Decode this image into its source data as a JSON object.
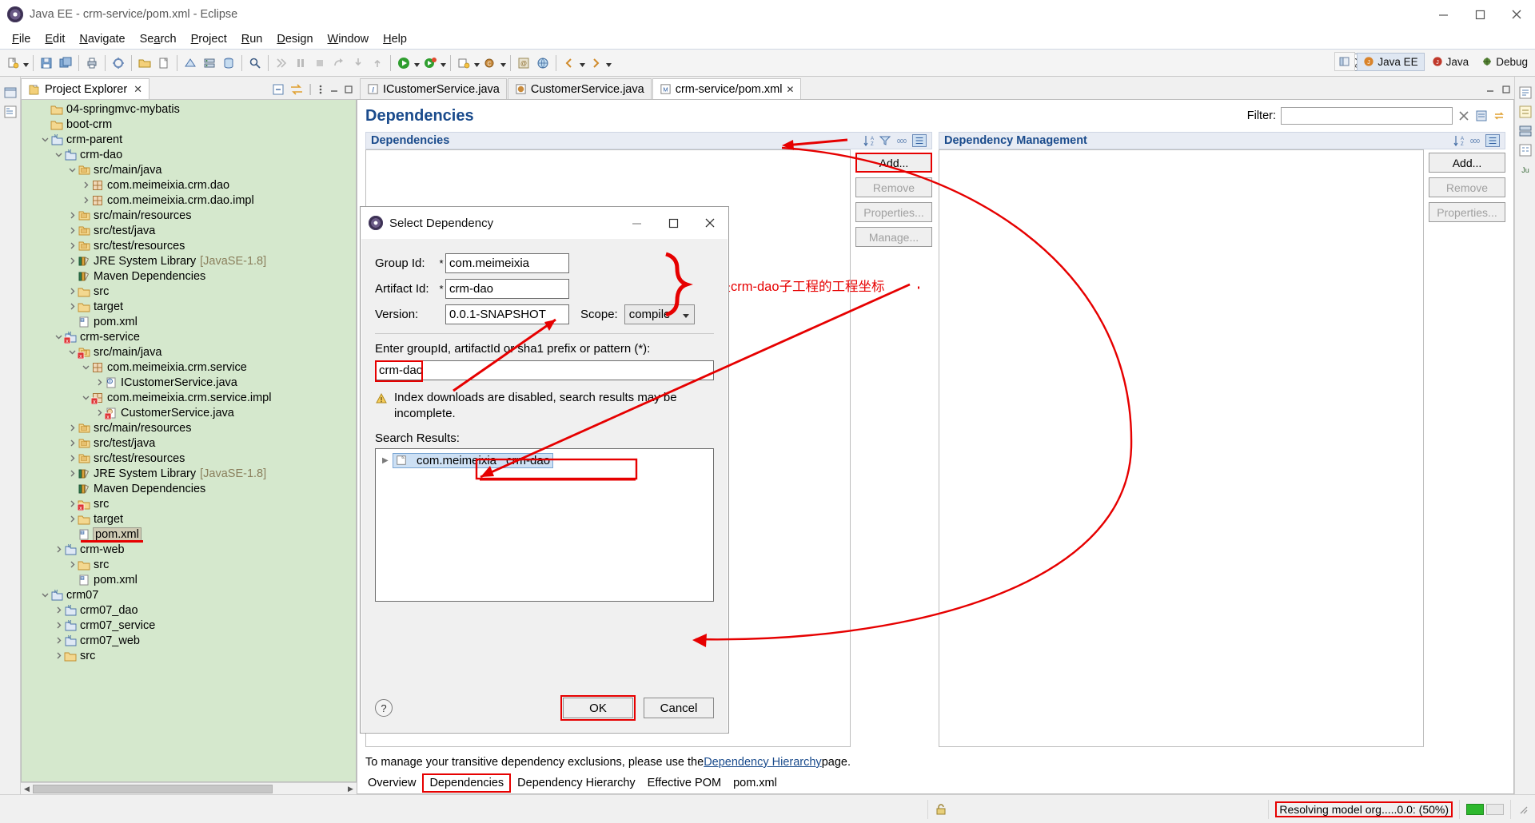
{
  "window": {
    "title": "Java EE - crm-service/pom.xml - Eclipse",
    "app_icon": "eclipse-icon",
    "minimize": "minimize-button",
    "maximize": "maximize-button",
    "close": "close-button"
  },
  "menubar": {
    "items": [
      {
        "label": "File",
        "mnemonic": "F"
      },
      {
        "label": "Edit",
        "mnemonic": "E"
      },
      {
        "label": "Navigate",
        "mnemonic": "N"
      },
      {
        "label": "Search",
        "mnemonic": "a"
      },
      {
        "label": "Project",
        "mnemonic": "P"
      },
      {
        "label": "Run",
        "mnemonic": "R"
      },
      {
        "label": "Design",
        "mnemonic": "D"
      },
      {
        "label": "Window",
        "mnemonic": "W"
      },
      {
        "label": "Help",
        "mnemonic": "H"
      }
    ]
  },
  "toolbar": {
    "quick_access": "Quick Access",
    "perspectives": [
      {
        "label": "Java EE",
        "active": true
      },
      {
        "label": "Java",
        "active": false
      },
      {
        "label": "Debug",
        "active": false
      }
    ]
  },
  "explorer": {
    "tab_label": "Project Explorer",
    "tab_close": "✕",
    "background_color": "#d5e8cd",
    "tree": [
      {
        "depth": 1,
        "twisty": "",
        "icon": "folder-icon",
        "label": "04-springmvc-mybatis",
        "suffix": ""
      },
      {
        "depth": 1,
        "twisty": "",
        "icon": "folder-icon",
        "label": "boot-crm",
        "suffix": ""
      },
      {
        "depth": 1,
        "twisty": "open",
        "icon": "maven-project-icon",
        "label": "crm-parent",
        "suffix": ""
      },
      {
        "depth": 2,
        "twisty": "open",
        "icon": "maven-project-icon",
        "label": "crm-dao",
        "suffix": ""
      },
      {
        "depth": 3,
        "twisty": "open",
        "icon": "source-folder-icon",
        "label": "src/main/java",
        "suffix": ""
      },
      {
        "depth": 4,
        "twisty": "closed",
        "icon": "package-icon",
        "label": "com.meimeixia.crm.dao",
        "suffix": ""
      },
      {
        "depth": 4,
        "twisty": "closed",
        "icon": "package-icon",
        "label": "com.meimeixia.crm.dao.impl",
        "suffix": ""
      },
      {
        "depth": 3,
        "twisty": "closed",
        "icon": "source-folder-icon",
        "label": "src/main/resources",
        "suffix": ""
      },
      {
        "depth": 3,
        "twisty": "closed",
        "icon": "source-folder-icon",
        "label": "src/test/java",
        "suffix": ""
      },
      {
        "depth": 3,
        "twisty": "closed",
        "icon": "source-folder-icon",
        "label": "src/test/resources",
        "suffix": ""
      },
      {
        "depth": 3,
        "twisty": "closed",
        "icon": "library-icon",
        "label": "JRE System Library",
        "suffix": "[JavaSE-1.8]"
      },
      {
        "depth": 3,
        "twisty": "",
        "icon": "library-icon",
        "label": "Maven Dependencies",
        "suffix": ""
      },
      {
        "depth": 3,
        "twisty": "closed",
        "icon": "folder-icon",
        "label": "src",
        "suffix": ""
      },
      {
        "depth": 3,
        "twisty": "closed",
        "icon": "folder-icon",
        "label": "target",
        "suffix": ""
      },
      {
        "depth": 3,
        "twisty": "",
        "icon": "pom-file-icon",
        "label": "pom.xml",
        "suffix": ""
      },
      {
        "depth": 2,
        "twisty": "open",
        "icon": "maven-project-error-icon",
        "label": "crm-service",
        "suffix": ""
      },
      {
        "depth": 3,
        "twisty": "open",
        "icon": "source-folder-error-icon",
        "label": "src/main/java",
        "suffix": ""
      },
      {
        "depth": 4,
        "twisty": "open",
        "icon": "package-icon",
        "label": "com.meimeixia.crm.service",
        "suffix": ""
      },
      {
        "depth": 5,
        "twisty": "closed",
        "icon": "java-interface-icon",
        "label": "ICustomerService.java",
        "suffix": ""
      },
      {
        "depth": 4,
        "twisty": "open",
        "icon": "package-error-icon",
        "label": "com.meimeixia.crm.service.impl",
        "suffix": ""
      },
      {
        "depth": 5,
        "twisty": "closed",
        "icon": "java-class-error-icon",
        "label": "CustomerService.java",
        "suffix": ""
      },
      {
        "depth": 3,
        "twisty": "closed",
        "icon": "source-folder-icon",
        "label": "src/main/resources",
        "suffix": ""
      },
      {
        "depth": 3,
        "twisty": "closed",
        "icon": "source-folder-icon",
        "label": "src/test/java",
        "suffix": ""
      },
      {
        "depth": 3,
        "twisty": "closed",
        "icon": "source-folder-icon",
        "label": "src/test/resources",
        "suffix": ""
      },
      {
        "depth": 3,
        "twisty": "closed",
        "icon": "library-icon",
        "label": "JRE System Library",
        "suffix": "[JavaSE-1.8]"
      },
      {
        "depth": 3,
        "twisty": "",
        "icon": "library-icon",
        "label": "Maven Dependencies",
        "suffix": ""
      },
      {
        "depth": 3,
        "twisty": "closed",
        "icon": "folder-error-icon",
        "label": "src",
        "suffix": ""
      },
      {
        "depth": 3,
        "twisty": "closed",
        "icon": "folder-icon",
        "label": "target",
        "suffix": ""
      },
      {
        "depth": 3,
        "twisty": "",
        "icon": "pom-file-icon",
        "label": "pom.xml",
        "suffix": "",
        "selected": true,
        "annotated": true
      },
      {
        "depth": 2,
        "twisty": "closed",
        "icon": "maven-project-icon",
        "label": "crm-web",
        "suffix": ""
      },
      {
        "depth": 3,
        "twisty": "closed",
        "icon": "folder-icon",
        "label": "src",
        "suffix": ""
      },
      {
        "depth": 3,
        "twisty": "",
        "icon": "pom-file-icon",
        "label": "pom.xml",
        "suffix": ""
      },
      {
        "depth": 1,
        "twisty": "open",
        "icon": "maven-project-icon",
        "label": "crm07",
        "suffix": ""
      },
      {
        "depth": 2,
        "twisty": "closed",
        "icon": "maven-project-icon",
        "label": "crm07_dao",
        "suffix": ""
      },
      {
        "depth": 2,
        "twisty": "closed",
        "icon": "maven-project-icon",
        "label": "crm07_service",
        "suffix": ""
      },
      {
        "depth": 2,
        "twisty": "closed",
        "icon": "maven-project-icon",
        "label": "crm07_web",
        "suffix": ""
      },
      {
        "depth": 2,
        "twisty": "closed",
        "icon": "folder-icon",
        "label": "src",
        "suffix": ""
      }
    ]
  },
  "editor": {
    "tabs": [
      {
        "label": "ICustomerService.java",
        "icon": "java-interface-icon",
        "active": false,
        "closable": false
      },
      {
        "label": "CustomerService.java",
        "icon": "java-class-icon",
        "active": false,
        "closable": false
      },
      {
        "label": "crm-service/pom.xml",
        "icon": "pom-file-icon",
        "active": true,
        "closable": true,
        "close": "✕"
      }
    ],
    "page_title": "Dependencies",
    "filter_label": "Filter:",
    "filter_value": "",
    "sections": [
      {
        "title": "Dependencies",
        "buttons": [
          {
            "label": "Add...",
            "enabled": true,
            "highlighted": true
          },
          {
            "label": "Remove",
            "enabled": false
          },
          {
            "label": "Properties...",
            "enabled": false
          },
          {
            "label": "Manage...",
            "enabled": false
          }
        ]
      },
      {
        "title": "Dependency Management",
        "buttons": [
          {
            "label": "Add...",
            "enabled": true,
            "highlighted": false
          },
          {
            "label": "Remove",
            "enabled": false
          },
          {
            "label": "Properties...",
            "enabled": false
          }
        ]
      }
    ],
    "footer_prefix": "To manage your transitive dependency exclusions, please use the ",
    "footer_link": "Dependency Hierarchy",
    "footer_suffix": " page.",
    "form_tabs": [
      {
        "label": "Overview",
        "active": false
      },
      {
        "label": "Dependencies",
        "active": true
      },
      {
        "label": "Dependency Hierarchy",
        "active": false
      },
      {
        "label": "Effective POM",
        "active": false
      },
      {
        "label": "pom.xml",
        "active": false
      }
    ]
  },
  "dialog": {
    "title": "Select Dependency",
    "icon": "eclipse-icon",
    "minimize": "—",
    "maximize": "□",
    "close": "✕",
    "fields": [
      {
        "label": "Group Id:",
        "required": true,
        "value": "com.meimeixia"
      },
      {
        "label": "Artifact Id:",
        "required": true,
        "value": "crm-dao"
      },
      {
        "label": "Version:",
        "required": false,
        "value": "0.0.1-SNAPSHOT"
      }
    ],
    "scope_label": "Scope:",
    "scope_value": "compile",
    "search_label": "Enter groupId, artifactId or sha1 prefix or pattern (*):",
    "search_value": "crm-dao",
    "warning_icon": "warning-icon",
    "warning_text": "Index downloads are disabled, search results may be incomplete.",
    "results_label": "Search Results:",
    "results": [
      {
        "twisty": "closed",
        "icon": "artifact-icon",
        "group": "com.meimeixia",
        "artifact": "crm-dao",
        "selected": true
      }
    ],
    "help_label": "?",
    "ok_label": "OK",
    "cancel_label": "Cancel"
  },
  "annotation": {
    "text": "这里就是crm-dao子工程的工程坐标",
    "color": "#e60000"
  },
  "statusbar": {
    "progress_text": "Resolving model org.....0.0: (50%)",
    "lock_icon": "writable-icon"
  }
}
